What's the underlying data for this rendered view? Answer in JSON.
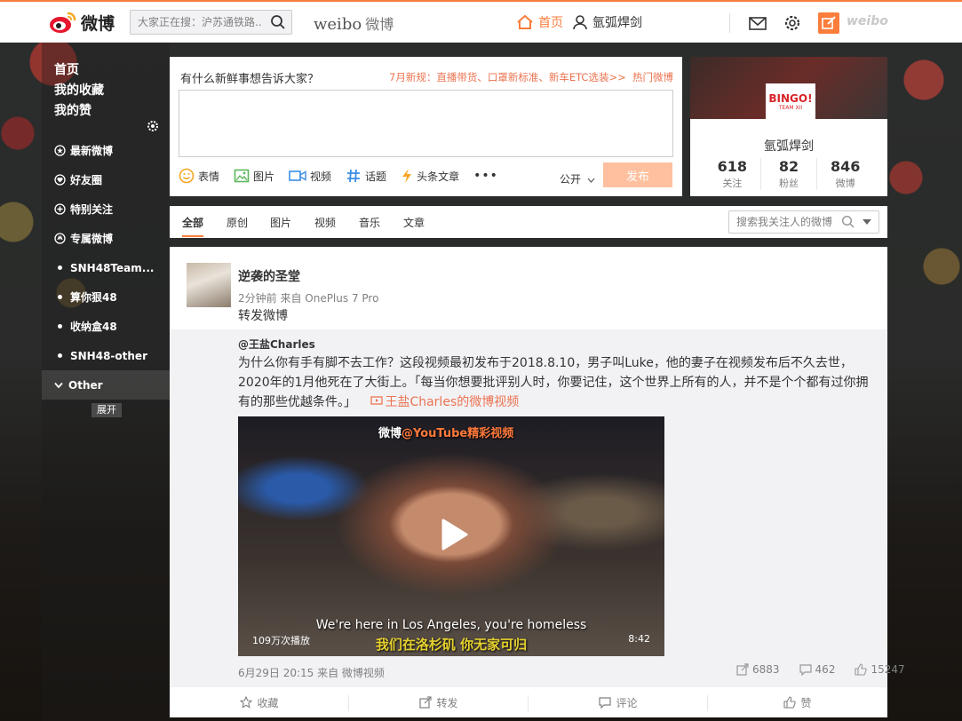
{
  "header": {
    "logo_text": "微博",
    "search_placeholder": "大家正在搜：沪苏通铁路...",
    "brand_en": "weibo",
    "brand_cn": "微博",
    "nav_home": "首页",
    "nav_user": "氩弧焊剑",
    "weibo_brand": "weibo",
    "accent": "#fa7d3c"
  },
  "sidebar": {
    "main": [
      "首页",
      "我的收藏",
      "我的赞"
    ],
    "items": [
      {
        "label": "最新微博",
        "icon": "star-icon"
      },
      {
        "label": "好友圈",
        "icon": "heart-icon"
      },
      {
        "label": "特别关注",
        "icon": "add-icon"
      },
      {
        "label": "专属微博",
        "icon": "exclusive-icon"
      },
      {
        "label": "SNH48Team...",
        "icon": "dot"
      },
      {
        "label": "算你狠48",
        "icon": "dot"
      },
      {
        "label": "收纳盒48",
        "icon": "dot"
      },
      {
        "label": "SNH48-other",
        "icon": "dot"
      },
      {
        "label": "Other",
        "icon": "chevron"
      }
    ],
    "expand": "展开"
  },
  "publisher": {
    "prompt": "有什么新鲜事想告诉大家？",
    "news": "7月新规：直播带货、口罩新标准、新车ETC选装>>",
    "hot": "热门微博",
    "tools": [
      {
        "label": "表情",
        "icon": "emoji-icon"
      },
      {
        "label": "图片",
        "icon": "image-icon"
      },
      {
        "label": "视频",
        "icon": "video-icon"
      },
      {
        "label": "话题",
        "icon": "hashtag-icon"
      },
      {
        "label": "头条文章",
        "icon": "article-icon"
      }
    ],
    "more": "•••",
    "visibility": "公开",
    "submit": "发布"
  },
  "profile": {
    "avatar_text": "BINGO!",
    "avatar_sub": "TEAM XII",
    "name": "氩弧焊剑",
    "stats": [
      {
        "num": "618",
        "label": "关注"
      },
      {
        "num": "82",
        "label": "粉丝"
      },
      {
        "num": "846",
        "label": "微博"
      }
    ]
  },
  "tabs": {
    "items": [
      "全部",
      "原创",
      "图片",
      "视频",
      "音乐",
      "文章"
    ],
    "search_placeholder": "搜索我关注人的微博"
  },
  "feed": {
    "author": "逆袭的圣堂",
    "meta": "2分钟前 来自 OnePlus 7 Pro",
    "text": "转发微博",
    "repost": {
      "author": "@王盐Charles",
      "body": "为什么你有手有脚不去工作？这段视频最初发布于2018.8.10，男子叫Luke，他的妻子在视频发布后不久去世，2020年的1月他死在了大街上。「每当你想要批评别人时，你要记住，这个世界上所有的人，并不是个个都有过你拥有的那些优越条件。」",
      "link": "王盐Charles的微博视频",
      "video": {
        "label_prefix": "微博",
        "label_accent": "@YouTube精彩视频",
        "sub_en": "We're here in Los Angeles, you're homeless",
        "sub_cn": "我们在洛杉矶 你无家可归",
        "views": "109万次播放",
        "duration": "8:42"
      },
      "time": "6月29日 20:15 来自 微博视频",
      "reposts": "6883",
      "comments": "462",
      "likes": "15247"
    },
    "actions": [
      {
        "label": "收藏",
        "icon": "star-outline-icon"
      },
      {
        "label": "转发",
        "icon": "share-icon"
      },
      {
        "label": "评论",
        "icon": "comment-icon"
      },
      {
        "label": "赞",
        "icon": "thumb-up-icon"
      }
    ]
  }
}
